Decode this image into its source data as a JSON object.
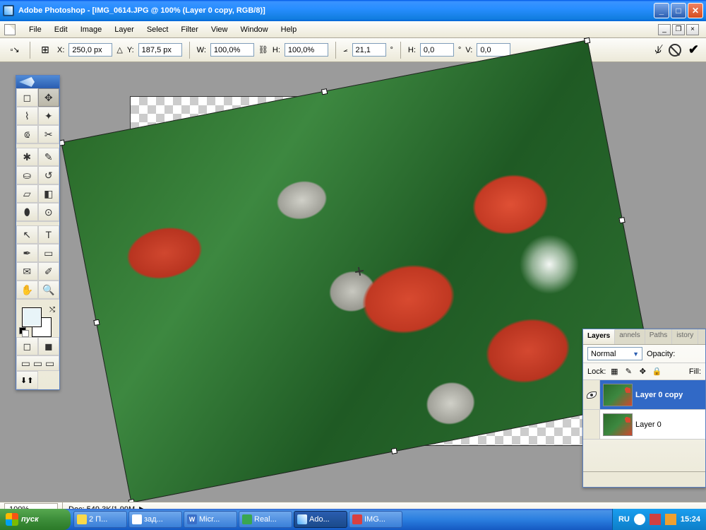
{
  "window": {
    "title": "Adobe Photoshop - [IMG_0614.JPG @ 100% (Layer 0 copy, RGB/8)]"
  },
  "menu": {
    "items": [
      "File",
      "Edit",
      "Image",
      "Layer",
      "Select",
      "Filter",
      "View",
      "Window",
      "Help"
    ]
  },
  "options": {
    "x_label": "X:",
    "x_value": "250,0 px",
    "y_label": "Y:",
    "y_value": "187,5 px",
    "w_label": "W:",
    "w_value": "100,0%",
    "h_label": "H:",
    "h_value": "100,0%",
    "angle_label": "",
    "angle_value": "21,1",
    "angle_unit": "°",
    "skew_h_label": "H:",
    "skew_h_value": "0,0",
    "skew_h_unit": "°",
    "skew_v_label": "V:",
    "skew_v_value": "0,0"
  },
  "transform": {
    "rotation_deg": -11
  },
  "status": {
    "zoom": "100%",
    "doc_info": "Doc: 549,3K/1,99M"
  },
  "layers_panel": {
    "tabs": [
      "Layers",
      "annels",
      "Paths",
      "istory"
    ],
    "blend_mode": "Normal",
    "opacity_label": "Opacity:",
    "lock_label": "Lock:",
    "fill_label": "Fill:",
    "layers": [
      {
        "name": "Layer 0 copy",
        "visible": true,
        "selected": true
      },
      {
        "name": "Layer 0",
        "visible": false,
        "selected": false
      }
    ]
  },
  "taskbar": {
    "start": "пуск",
    "buttons": [
      {
        "label": "2 П...",
        "active": false
      },
      {
        "label": "зад...",
        "active": false
      },
      {
        "label": "Micr...",
        "active": false
      },
      {
        "label": "Real...",
        "active": false
      },
      {
        "label": "Ado...",
        "active": true
      },
      {
        "label": "IMG...",
        "active": false
      }
    ],
    "lang": "RU",
    "clock": "15:24"
  },
  "colors": {
    "xp_blue": "#2b7fe0",
    "xp_green": "#3d8e3a",
    "panel_bg": "#ece9d8",
    "selection_blue": "#3169c6"
  }
}
